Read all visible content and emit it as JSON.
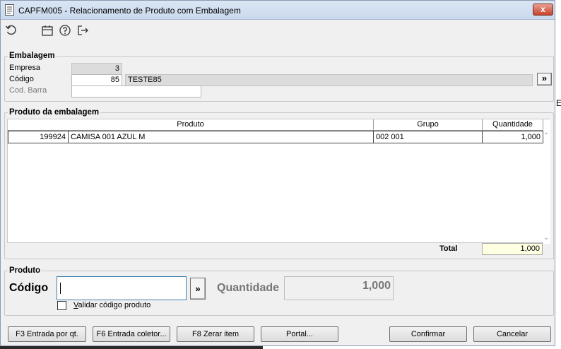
{
  "window": {
    "title": "CAPFM005 - Relacionamento de Produto com Embalagem",
    "close_label": "x"
  },
  "toolbar": {
    "icons": [
      "undo-icon",
      "calendar-icon",
      "help-icon",
      "exit-icon"
    ]
  },
  "embalagem": {
    "legend": "Embalagem",
    "empresa_label": "Empresa",
    "empresa_value": "3",
    "codigo_label": "Código",
    "codigo_value": "85",
    "codigo_desc": "TESTE85",
    "lookup_button": "»",
    "codbarra_label": "Cod. Barra",
    "codbarra_value": ""
  },
  "produto_embalagem": {
    "legend": "Produto da embalagem",
    "columns": [
      "Produto",
      "Grupo",
      "Quantidade"
    ],
    "rows": [
      {
        "codigo": "199924",
        "descricao": "CAMISA 001 AZUL M",
        "grupo": "002 001",
        "quantidade": "1,000"
      }
    ],
    "total_label": "Total",
    "total_value": "1,000"
  },
  "produto": {
    "legend": "Produto",
    "codigo_label": "Código",
    "codigo_value": "",
    "lookup_button": "»",
    "quantidade_label": "Quantidade",
    "quantidade_value": "1,000",
    "validar_label_underlined": "V",
    "validar_label_rest": "alidar código produto",
    "validar_checked": false
  },
  "buttons": {
    "f3": "F3 Entrada por qt.",
    "f6": "F6 Entrada coletor...",
    "f8": "F8 Zerar item",
    "portal": "Portal...",
    "confirmar": "Confirmar",
    "cancelar": "Cancelar"
  },
  "partial_text": "E"
}
